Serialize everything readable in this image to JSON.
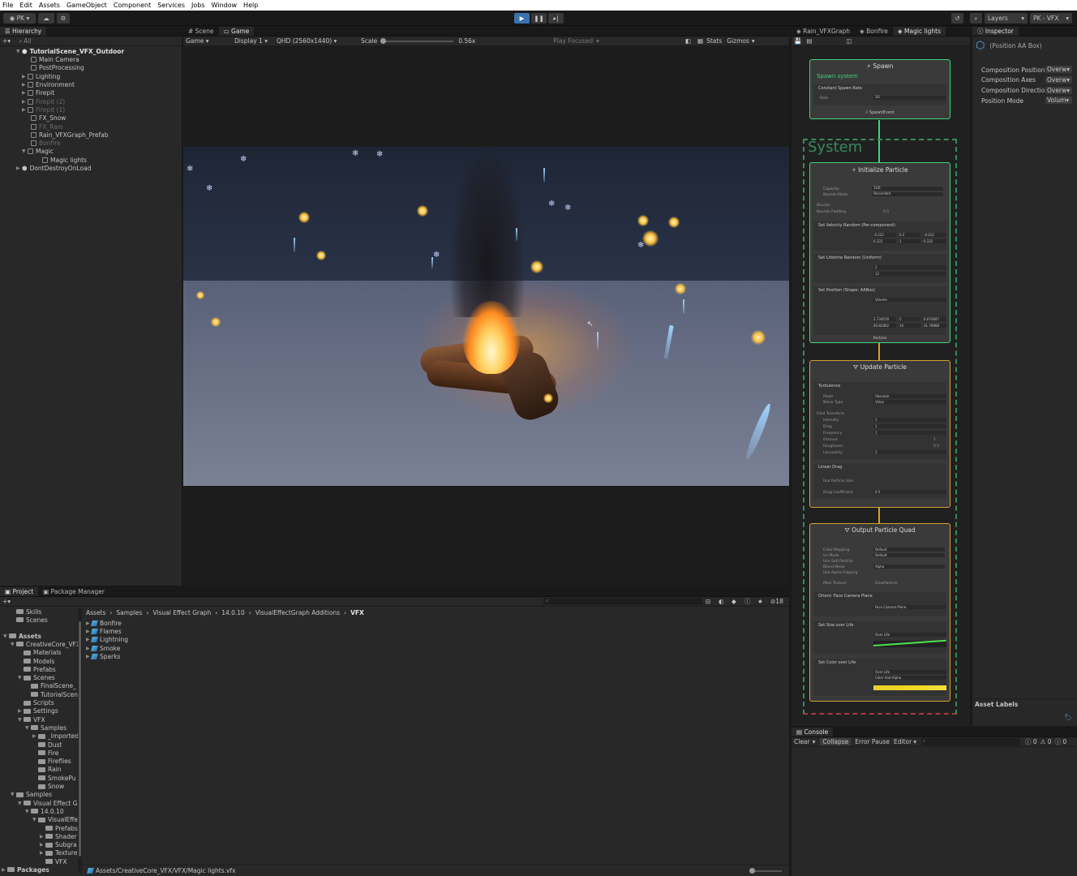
{
  "menu": [
    "File",
    "Edit",
    "Assets",
    "GameObject",
    "Component",
    "Services",
    "Jobs",
    "Window",
    "Help"
  ],
  "toolbar": {
    "account": "PK",
    "layers": "Layers",
    "layout": "PK - VFX"
  },
  "hierarchy": {
    "tab": "Hierarchy",
    "search_placeholder": "All",
    "scene": "TutorialScene_VFX_Outdoor",
    "items": [
      {
        "label": "Main Camera",
        "dim": false
      },
      {
        "label": "PostProcessing",
        "dim": false
      },
      {
        "label": "Lighting",
        "dim": false
      },
      {
        "label": "Environment",
        "dim": false
      },
      {
        "label": "Firepit",
        "dim": false
      },
      {
        "label": "Firepit (2)",
        "dim": true
      },
      {
        "label": "Firepit (1)",
        "dim": true
      },
      {
        "label": "FX_Snow",
        "dim": false
      },
      {
        "label": "FX_Rain",
        "dim": true
      },
      {
        "label": "Rain_VFXGraph_Prefab",
        "dim": false
      },
      {
        "label": "Bonfire",
        "dim": true
      },
      {
        "label": "Magic",
        "dim": false
      },
      {
        "label": "Magic lights",
        "dim": false
      }
    ],
    "dontdestroy": "DontDestroyOnLoad"
  },
  "game": {
    "tabs": [
      "Scene",
      "Game"
    ],
    "mode": "Game",
    "display": "Display 1",
    "resolution": "QHD (2560x1440)",
    "scale_label": "Scale",
    "scale_value": "0.56x",
    "play_focused": "Play Focused",
    "stats": "Stats",
    "gizmos": "Gizmos"
  },
  "vfx": {
    "tabs": [
      "Rain_VFXGraph",
      "Bonfire",
      "Magic lights"
    ],
    "spawn_title": "Spawn",
    "spawn_system": "Spawn system",
    "constant_spawn": "Constant Spawn Rate",
    "rate_label": "Rate",
    "rate_value": "10",
    "spawn_event": "SpawnEvent",
    "system_label": "System",
    "init_title": "Initialize Particle",
    "init_fields": [
      "Capacity",
      "Bounds Mode",
      "Bounds",
      "Bounds Padding"
    ],
    "init_values": [
      "100",
      "Recorded",
      "",
      "0.5"
    ],
    "blocks_init": [
      "Set Velocity Random (Per-component)",
      "Set Lifetime Random (Uniform)",
      "Set Position (Shape: AABox)"
    ],
    "velocity": {
      "ax": "-0.222",
      "ay": "0.2",
      "az": "-0.222",
      "bx": "0.222",
      "by": "1",
      "bz": "0.222"
    },
    "lifetime": {
      "a": "2",
      "b": "12"
    },
    "position_mode": "Volume",
    "box_center": [
      "2.734078",
      "5",
      "0.674847"
    ],
    "box_size": [
      "40.82802",
      "10",
      "31.78988"
    ],
    "update_title": "Update Particle",
    "turbulence": "Turbulence",
    "turb_fields": [
      "Mode",
      "Noise Type",
      "Field Transform",
      "Intensity",
      "Drag",
      "Frequency",
      "Octaves",
      "Roughness",
      "Lacunarity"
    ],
    "turb_values": [
      "Absolute",
      "Value",
      "",
      "1",
      "1",
      "1",
      "1",
      "0.5",
      "2"
    ],
    "linear_drag": "Linear Drag",
    "drag_fields": [
      "Use Particle Size",
      "Drag Coefficient"
    ],
    "drag_value": "0.5",
    "particle_label": "Particle",
    "output_title": "Output Particle Quad",
    "output_fields": [
      "Color Mapping",
      "Uv Mode",
      "Use Soft Particle",
      "Blend Mode",
      "Use Alpha Clipping",
      "Main Texture"
    ],
    "output_values": [
      "Default",
      "Default",
      "",
      "Alpha",
      "",
      "GlowParticle"
    ],
    "orient_block": "Orient: Face Camera Plane",
    "orient_mode": "Face Camera Plane",
    "size_block": "Set Size over Life",
    "size_value": "Over Life",
    "color_block": "Set Color over Life",
    "color_values": [
      "Over Life",
      "Color And Alpha"
    ],
    "context_badge": "(+)"
  },
  "inspector": {
    "tab": "Inspector",
    "title": "(Position AA Box)",
    "rows": [
      {
        "label": "Composition Position",
        "value": "Overw"
      },
      {
        "label": "Composition Axes",
        "value": "Overw"
      },
      {
        "label": "Composition Direction",
        "value": "Overw"
      },
      {
        "label": "Position Mode",
        "value": "Volum"
      }
    ],
    "asset_labels": "Asset Labels"
  },
  "console": {
    "tab": "Console",
    "buttons": [
      "Clear",
      "Collapse",
      "Error Pause",
      "Editor"
    ],
    "counts": [
      "0",
      "0",
      "0"
    ]
  },
  "project": {
    "tabs": [
      "Project",
      "Package Manager"
    ],
    "favorites": [
      "Skills",
      "Scenes"
    ],
    "tree": [
      {
        "label": "Assets",
        "level": 0
      },
      {
        "label": "CreativeCore_VFX",
        "level": 1
      },
      {
        "label": "Materials",
        "level": 2
      },
      {
        "label": "Models",
        "level": 2
      },
      {
        "label": "Prefabs",
        "level": 2
      },
      {
        "label": "Scenes",
        "level": 2
      },
      {
        "label": "FinalScene_",
        "level": 3
      },
      {
        "label": "TutorialScen",
        "level": 3
      },
      {
        "label": "Scripts",
        "level": 2
      },
      {
        "label": "Settings",
        "level": 2
      },
      {
        "label": "VFX",
        "level": 2
      },
      {
        "label": "Samples",
        "level": 3
      },
      {
        "label": "_Imported",
        "level": 4
      },
      {
        "label": "Dust",
        "level": 4
      },
      {
        "label": "Fire",
        "level": 4
      },
      {
        "label": "Fireflies",
        "level": 4
      },
      {
        "label": "Rain",
        "level": 4
      },
      {
        "label": "SmokePu",
        "level": 4
      },
      {
        "label": "Snow",
        "level": 4
      },
      {
        "label": "Samples",
        "level": 1
      },
      {
        "label": "Visual Effect G",
        "level": 2
      },
      {
        "label": "14.0.10",
        "level": 3
      },
      {
        "label": "VisualEffe",
        "level": 4
      },
      {
        "label": "Prefabs",
        "level": 5
      },
      {
        "label": "Shader",
        "level": 5
      },
      {
        "label": "Subgra",
        "level": 5
      },
      {
        "label": "Texture",
        "level": 5
      },
      {
        "label": "VFX",
        "level": 5
      }
    ],
    "packages": "Packages",
    "breadcrumb": [
      "Assets",
      "Samples",
      "Visual Effect Graph",
      "14.0.10",
      "VisualEffectGraph Additions",
      "VFX"
    ],
    "files": [
      "Bonfire",
      "Flames",
      "Lightning",
      "Smoke",
      "Sparks"
    ],
    "hidden_count": "18",
    "status_path": "Assets/CreativeCore_VFX/VFX/Magic lights.vfx"
  }
}
